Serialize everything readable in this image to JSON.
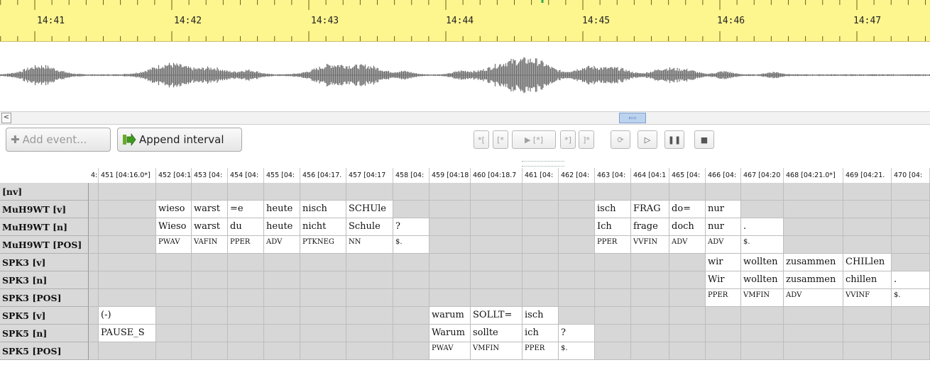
{
  "timeline": {
    "labels": [
      "14:41",
      "14:42",
      "14:43",
      "14:44",
      "14:45",
      "14:46",
      "14:47"
    ],
    "background": "#fdf58e"
  },
  "scrollbar": {
    "left_arrow": "<"
  },
  "toolbar": {
    "add_event_label": "Add event...",
    "append_interval_label": "Append interval",
    "transport": [
      {
        "name": "play-start-bracket-button",
        "glyph": "*[",
        "active": false
      },
      {
        "name": "play-bracket-start-button",
        "glyph": "[*",
        "active": false
      },
      {
        "name": "play-selection-button",
        "glyph": "▶ [*]",
        "active": false
      },
      {
        "name": "play-end-bracket-button",
        "glyph": "*]",
        "active": false
      },
      {
        "name": "play-bracket-end-button",
        "glyph": "]*",
        "active": false
      },
      {
        "name": "loop-icon",
        "glyph": "⟳",
        "active": false
      },
      {
        "name": "play-button",
        "glyph": "▷",
        "active": true
      },
      {
        "name": "pause-button",
        "glyph": "❚❚",
        "active": true
      },
      {
        "name": "stop-button",
        "glyph": "■",
        "active": true
      }
    ]
  },
  "grid": {
    "columns": [
      "4:",
      "451 [04:16.0*]",
      "452 [04:1",
      "453 [04:",
      "454 [04:",
      "455 [04:",
      "456 [04:17.",
      "457 [04:17",
      "458 [04:",
      "459 [04:18",
      "460 [04:18.7",
      "461 [04:",
      "462 [04:",
      "463 [04:",
      "464 [04:1",
      "465 [04:",
      "466 [04:",
      "467 [04:20",
      "468 [04:21.0*]",
      "469 [04:21.",
      "470 [04:"
    ],
    "tiers": [
      {
        "label": "[nv]",
        "type": "text",
        "cells": {}
      },
      {
        "label": "MuH9WT [v]",
        "type": "text",
        "cells": {
          "2": "wieso",
          "3": "warst",
          "4": "=e",
          "5": "heute",
          "6": "nisch",
          "7": "SCHUle",
          "13": "isch",
          "14": "FRAG",
          "15": "do=",
          "16": "nur"
        }
      },
      {
        "label": "MuH9WT [n]",
        "type": "text",
        "cells": {
          "2": "Wieso",
          "3": "warst",
          "4": "du",
          "5": "heute",
          "6": "nicht",
          "7": "Schule",
          "8": "?",
          "13": "Ich",
          "14": "frage",
          "15": "doch",
          "16": "nur",
          "17": "."
        }
      },
      {
        "label": "MuH9WT [POS]",
        "type": "pos",
        "cells": {
          "2": "PWAV",
          "3": "VAFIN",
          "4": "PPER",
          "5": "ADV",
          "6": "PTKNEG",
          "7": "NN",
          "8": "$.",
          "13": "PPER",
          "14": "VVFIN",
          "15": "ADV",
          "16": "ADV",
          "17": "$."
        }
      },
      {
        "label": "SPK3 [v]",
        "type": "text",
        "cells": {
          "16": "wir",
          "17": "wollten",
          "18": "zusammen",
          "19": "CHILlen"
        }
      },
      {
        "label": "SPK3 [n]",
        "type": "text",
        "cells": {
          "16": "Wir",
          "17": "wollten",
          "18": "zusammen",
          "19": "chillen",
          "20": "."
        }
      },
      {
        "label": "SPK3 [POS]",
        "type": "pos",
        "cells": {
          "16": "PPER",
          "17": "VMFIN",
          "18": "ADV",
          "19": "VVINF",
          "20": "$."
        }
      },
      {
        "label": "SPK5 [v]",
        "type": "text",
        "cells": {
          "1": "(-)",
          "9": "warum",
          "10": "SOLLT=",
          "11": "isch"
        }
      },
      {
        "label": "SPK5 [n]",
        "type": "text",
        "cells": {
          "1": "PAUSE_S",
          "9": "Warum",
          "10": "sollte",
          "11": "ich",
          "12": "?"
        }
      },
      {
        "label": "SPK5 [POS]",
        "type": "pos",
        "cells": {
          "9": "PWAV",
          "10": "VMFIN",
          "11": "PPER",
          "12": "$."
        }
      }
    ]
  }
}
